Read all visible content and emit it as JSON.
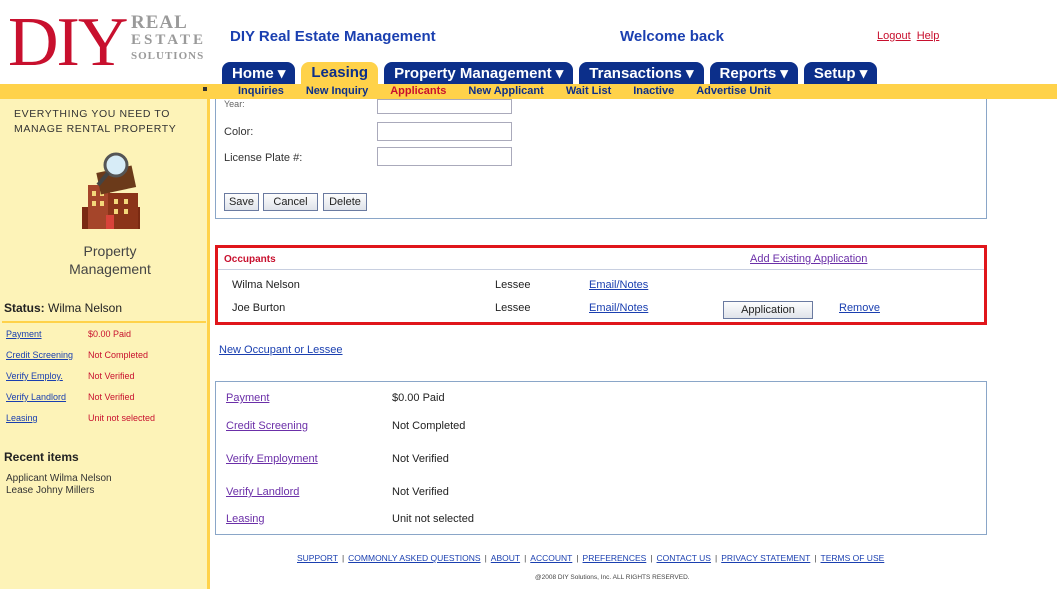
{
  "logo": {
    "main": "DIY",
    "line1": "REAL",
    "line2": "ESTATE",
    "line3": "SOLUTIONS"
  },
  "header": {
    "title": "DIY Real Estate Management",
    "welcome": "Welcome back",
    "logout": "Logout",
    "help": "Help"
  },
  "nav": {
    "tabs": [
      {
        "label": "Home ▾"
      },
      {
        "label": "Leasing"
      },
      {
        "label": "Property Management ▾"
      },
      {
        "label": "Transactions ▾"
      },
      {
        "label": "Reports ▾"
      },
      {
        "label": "Setup ▾"
      }
    ],
    "active_tab": "Leasing",
    "subitems": [
      {
        "label": "Inquiries"
      },
      {
        "label": "New Inquiry"
      },
      {
        "label": "Applicants"
      },
      {
        "label": "New Applicant"
      },
      {
        "label": "Wait List"
      },
      {
        "label": "Inactive"
      },
      {
        "label": "Advertise Unit"
      }
    ],
    "active_subitem": "Applicants"
  },
  "sidebar": {
    "tagline": "EVERYTHING YOU NEED TO MANAGE RENTAL PROPERTY",
    "section_line1": "Property",
    "section_line2": "Management",
    "status_label": "Status:",
    "status_name": "Wilma Nelson",
    "status_items": [
      {
        "label": "Payment",
        "value": "$0.00 Paid"
      },
      {
        "label": "Credit Screening",
        "value": "Not Completed"
      },
      {
        "label": "Verify Employ.",
        "value": "Not Verified"
      },
      {
        "label": "Verify Landlord",
        "value": "Not Verified"
      },
      {
        "label": "Leasing",
        "value": "Unit not selected"
      }
    ],
    "recent_title": "Recent items",
    "recent_items": [
      "Applicant Wilma Nelson",
      "Lease Johny Millers"
    ]
  },
  "vehicle_form": {
    "year_label": "Year:",
    "color_label": "Color:",
    "plate_label": "License Plate #:",
    "year_value": "",
    "color_value": "",
    "plate_value": "",
    "save": "Save",
    "cancel": "Cancel",
    "delete": "Delete"
  },
  "occupants": {
    "title": "Occupants",
    "add_existing": "Add Existing Application",
    "rows": [
      {
        "name": "Wilma Nelson",
        "role": "Lessee",
        "notes": "Email/Notes"
      },
      {
        "name": "Joe Burton",
        "role": "Lessee",
        "notes": "Email/Notes",
        "button": "Application",
        "remove": "Remove"
      }
    ]
  },
  "new_occupant": "New Occupant or Lessee",
  "status_panel": [
    {
      "label": "Payment",
      "value": "$0.00 Paid"
    },
    {
      "label": "Credit Screening",
      "value": "Not Completed"
    },
    {
      "label": "Verify Employment",
      "value": "Not Verified"
    },
    {
      "label": "Verify Landlord",
      "value": "Not Verified"
    },
    {
      "label": "Leasing",
      "value": "Unit not selected"
    }
  ],
  "footer": {
    "links": [
      "SUPPORT",
      "COMMONLY ASKED QUESTIONS",
      "ABOUT",
      "ACCOUNT",
      "PREFERENCES",
      "CONTACT US",
      "PRIVACY STATEMENT",
      "TERMS OF USE"
    ],
    "copyright": "@2008 DIY Solutions, Inc. ALL RIGHTS RESERVED."
  },
  "colors": {
    "brand_red": "#c8102e",
    "nav_blue": "#0c2f8a",
    "accent_yellow": "#ffd24a",
    "sidebar_bg": "#fdf3b8",
    "highlight_border": "#e0161b"
  }
}
